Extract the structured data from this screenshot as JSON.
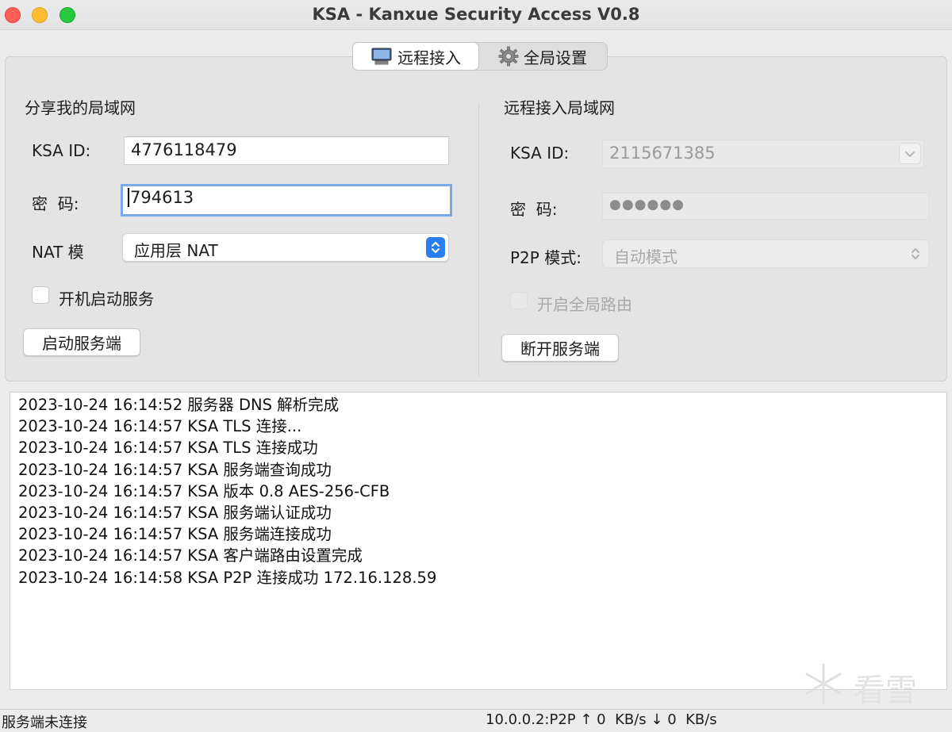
{
  "window": {
    "title": "KSA - Kanxue Security Access V0.8"
  },
  "tabs": [
    {
      "label": "远程接入",
      "icon": "computer-icon",
      "active": true
    },
    {
      "label": "全局设置",
      "icon": "gear-icon",
      "active": false
    }
  ],
  "share": {
    "title": "分享我的局域网",
    "id_label": "KSA ID:",
    "id_value": "4776118479",
    "password_label": "密  码:",
    "password_value": "794613",
    "nat_label": "NAT 模",
    "nat_value": "应用层 NAT",
    "autostart_label": "开机启动服务",
    "autostart_checked": false,
    "start_button": "启动服务端"
  },
  "remote": {
    "title": "远程接入局域网",
    "id_label": "KSA ID:",
    "id_value": "2115671385",
    "password_label": "密  码:",
    "password_value": "●●●●●●",
    "p2p_label": "P2P 模式:",
    "p2p_value": "自动模式",
    "global_route_label": "开启全局路由",
    "global_route_checked": false,
    "disconnect_button": "断开服务端"
  },
  "log": [
    "2023-10-24 16:14:52 服务器 DNS 解析完成",
    "2023-10-24 16:14:57 KSA TLS 连接...",
    "2023-10-24 16:14:57 KSA TLS 连接成功",
    "2023-10-24 16:14:57 KSA 服务端查询成功",
    "2023-10-24 16:14:57 KSA 版本 0.8 AES-256-CFB",
    "2023-10-24 16:14:57 KSA 服务端认证成功",
    "2023-10-24 16:14:57 KSA 服务端连接成功",
    "2023-10-24 16:14:57 KSA 客户端路由设置完成",
    "2023-10-24 16:14:58 KSA P2P 连接成功 172.16.128.59"
  ],
  "watermark": {
    "text": "看雪"
  },
  "status": {
    "left": "服务端未连接",
    "right": "10.0.0.2:P2P ↑ 0  KB/s ↓ 0  KB/s"
  },
  "colors": {
    "accent": "#2a7ef0",
    "focus_ring": "#7aa8e8",
    "close": "#fe5f57",
    "minimize": "#febc2e",
    "maximize": "#28c840"
  }
}
